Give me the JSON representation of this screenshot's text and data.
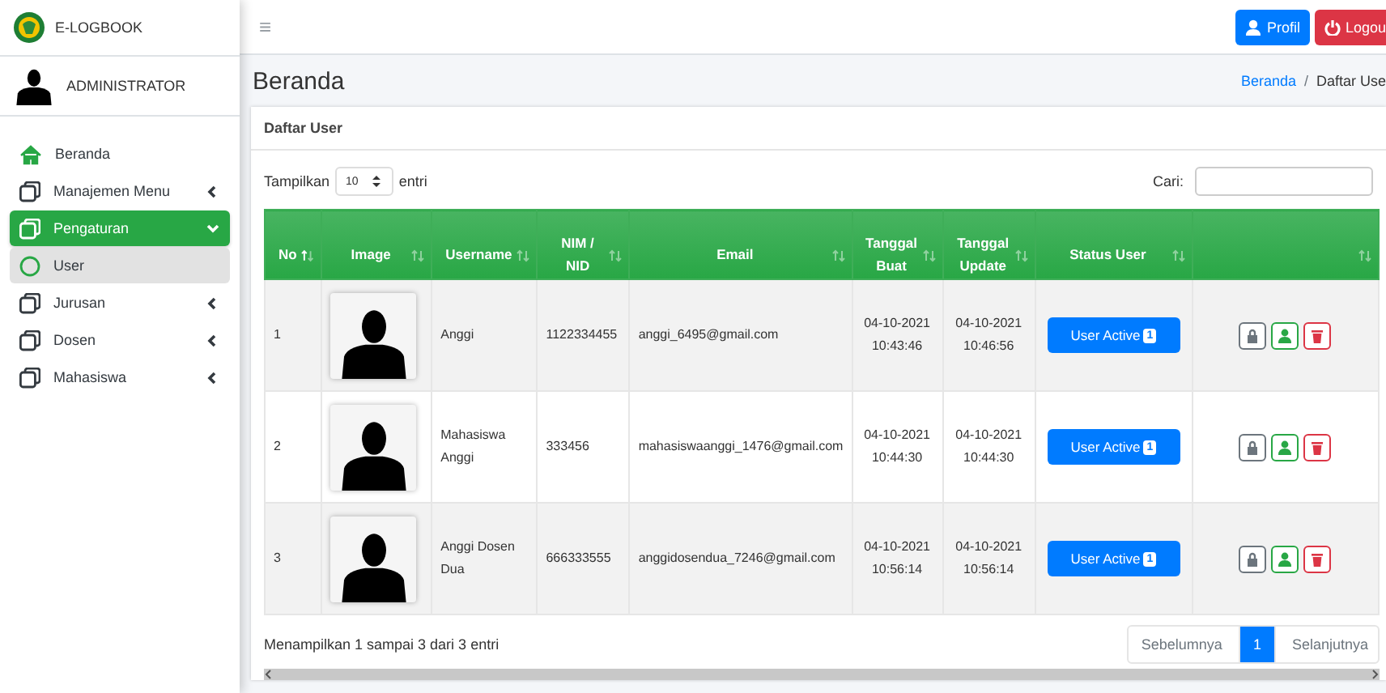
{
  "sidebar": {
    "brand": "E-LOGBOOK",
    "user": "ADMINISTRATOR",
    "items": [
      {
        "kind": "link",
        "label": "Beranda",
        "selected": false
      },
      {
        "kind": "menu",
        "label": "Manajemen Menu",
        "selected": false,
        "expanded": false
      },
      {
        "kind": "menu",
        "label": "Pengaturan",
        "selected": true,
        "expanded": true,
        "children": [
          {
            "label": "User",
            "selected": true
          }
        ]
      },
      {
        "kind": "menu",
        "label": "Jurusan",
        "selected": false,
        "expanded": false
      },
      {
        "kind": "menu",
        "label": "Dosen",
        "selected": false,
        "expanded": false
      },
      {
        "kind": "menu",
        "label": "Mahasiswa",
        "selected": false,
        "expanded": false
      }
    ]
  },
  "topbar": {
    "menu_glyph": "≡",
    "buttons": [
      {
        "kind": "profile",
        "label": "Profil"
      },
      {
        "kind": "logout",
        "label": "Logou"
      }
    ]
  },
  "page": {
    "title": "Beranda",
    "breadcrumb": [
      {
        "label": "Beranda",
        "active": false
      },
      {
        "label": "Daftar Use",
        "active": true
      }
    ],
    "separator": "/"
  },
  "card": {
    "title": "Daftar User",
    "length_label": "Tampilkan",
    "length_value": "10",
    "length_suffix": "entri",
    "search_label": "Cari:",
    "table": {
      "columns": [
        {
          "label": "No",
          "sorted": true
        },
        {
          "label": "Image",
          "sorted": false
        },
        {
          "label": "Username",
          "sorted": false
        },
        {
          "label": "NIM / NID",
          "sorted": false
        },
        {
          "label": "Email",
          "sorted": false
        },
        {
          "label": "Tanggal Buat",
          "sorted": false
        },
        {
          "label": "Tanggal Update",
          "sorted": false
        },
        {
          "label": "Status User",
          "sorted": false
        },
        {
          "sorted": false
        }
      ],
      "rows": [
        {
          "no": "1",
          "username": "Anggi",
          "nim": "1122334455",
          "email": "anggi_6495@gmail.com",
          "created": [
            "04-10-2021",
            "10:43:46"
          ],
          "updated": [
            "04-10-2021",
            "10:46:56"
          ],
          "status": "User Active",
          "badge": "1"
        },
        {
          "no": "2",
          "username": "Mahasiswa Anggi",
          "nim": "333456",
          "email": "mahasiswaanggi_1476@gmail.com",
          "created": [
            "04-10-2021",
            "10:44:30"
          ],
          "updated": [
            "04-10-2021",
            "10:44:30"
          ],
          "status": "User Active",
          "badge": "1"
        },
        {
          "no": "3",
          "username": "Anggi Dosen Dua",
          "nim": "666333555",
          "email": "anggidosendua_7246@gmail.com",
          "created": [
            "04-10-2021",
            "10:56:14"
          ],
          "updated": [
            "04-10-2021",
            "10:56:14"
          ],
          "status": "User Active",
          "badge": "1"
        }
      ]
    },
    "info": "Menampilkan 1 sampai 3 dari 3 entri",
    "pagination": [
      {
        "kind": "prev",
        "label": "Sebelumnya",
        "selected": false
      },
      {
        "kind": "page",
        "label": "1",
        "selected": true
      },
      {
        "kind": "next",
        "label": "Selanjutnya",
        "selected": false
      }
    ]
  }
}
